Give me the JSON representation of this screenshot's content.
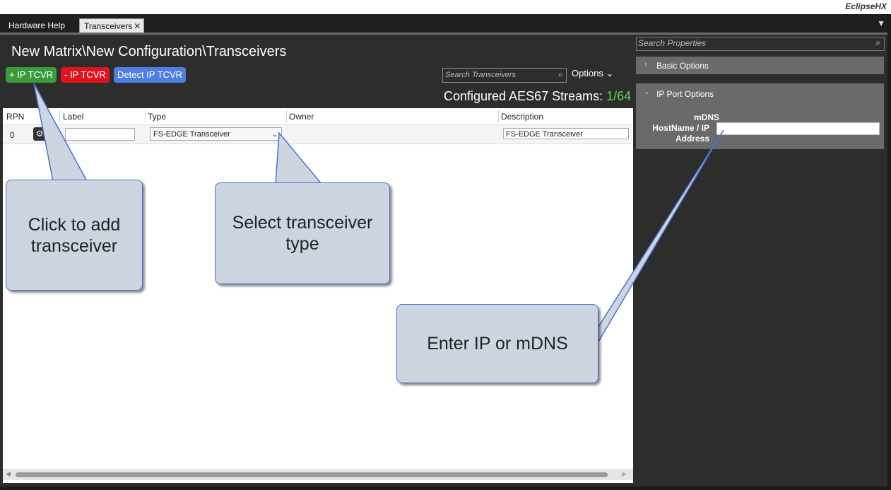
{
  "app": {
    "brand": "EclipseHX"
  },
  "tabs": [
    {
      "label": "Hardware Help"
    },
    {
      "label": "Transceivers",
      "close": "✕"
    }
  ],
  "tab_menu_icon": "▼",
  "main": {
    "title": "New Matrix\\New Configuration\\Transceivers",
    "buttons": {
      "add": "+ IP TCVR",
      "remove": "- IP TCVR",
      "detect": "Detect IP TCVR"
    },
    "search": {
      "placeholder": "Search Transceivers",
      "icon": "search-icon"
    },
    "options_label": "Options",
    "streams": {
      "label": "Configured AES67 Streams:",
      "count": "1/64"
    },
    "colors": {
      "add": "#3a9b3a",
      "remove": "#e0141e",
      "detect": "#4e7fe0",
      "count": "#5fd35f"
    }
  },
  "grid": {
    "columns": [
      "RPN",
      "Label",
      "Type",
      "Owner",
      "Description"
    ],
    "rows": [
      {
        "rpn": "0",
        "label": "",
        "type": "FS-EDGE Transceiver",
        "owner": "",
        "description": "FS-EDGE Transceiver"
      }
    ]
  },
  "properties": {
    "search": {
      "placeholder": "Search Properties"
    },
    "sections": [
      {
        "label": "Basic Options",
        "expanded": false
      },
      {
        "label": "IP Port Options",
        "expanded": true
      }
    ],
    "host_field": {
      "label_line1": "mDNS",
      "label_line2": "HostName / IP",
      "label_line3": "Address",
      "value": ""
    }
  },
  "callouts": {
    "add": "Click to add transceiver",
    "type": "Select transceiver type",
    "ip": "Enter IP or mDNS"
  }
}
